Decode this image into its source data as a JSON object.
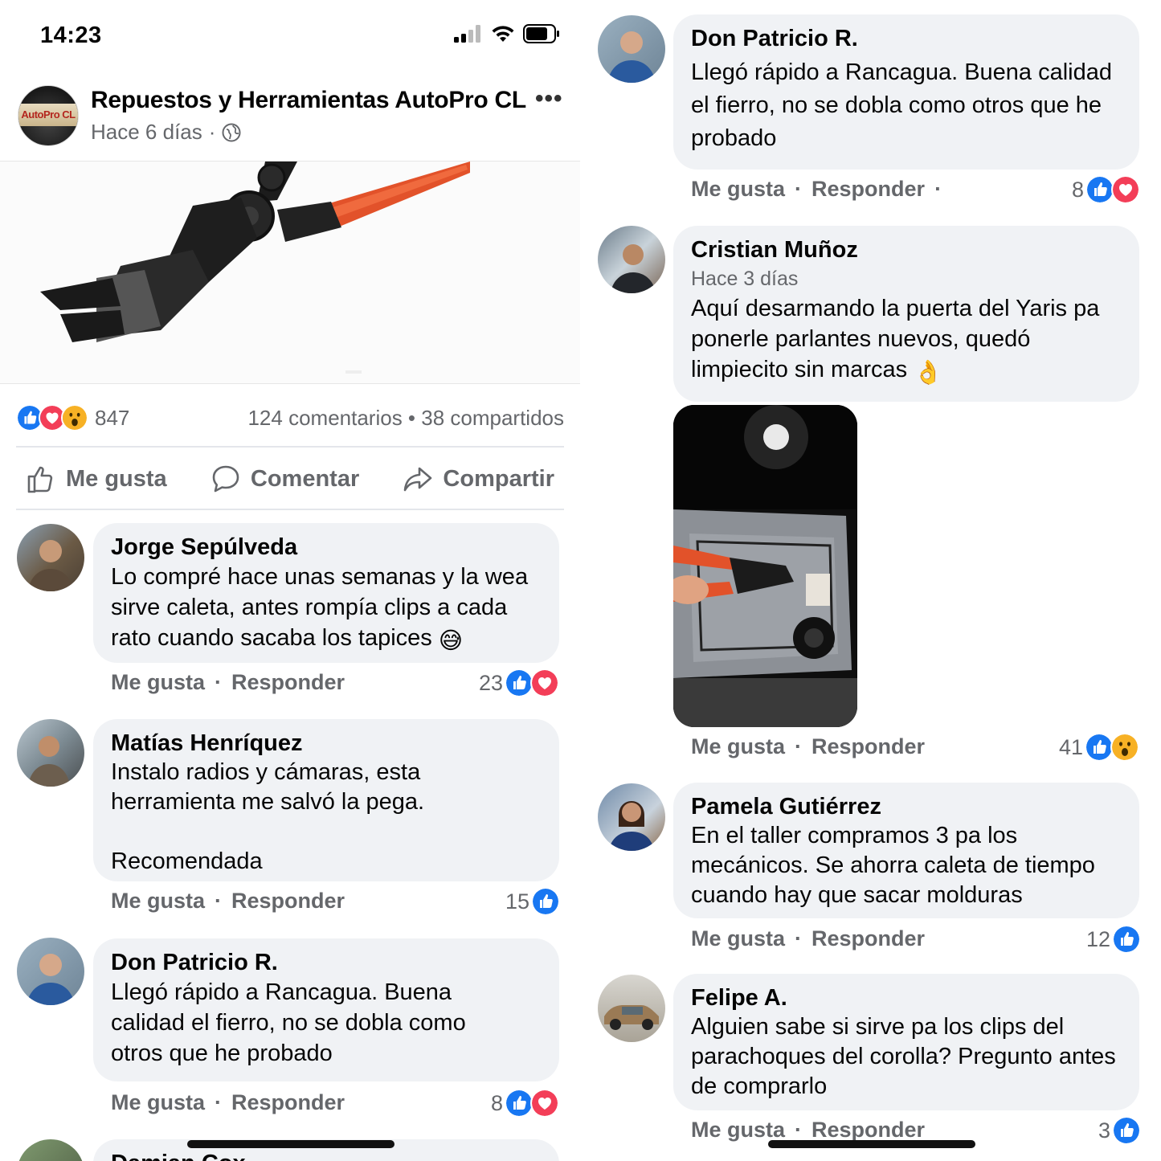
{
  "status_bar": {
    "time": "14:23"
  },
  "post": {
    "page_name": "Repuestos y Herramientas AutoPro CL",
    "avatar_text": "AutoPro CL",
    "time": "Hace 6 días",
    "separator": "·",
    "reaction_count": "847",
    "comments_shares": "124 comentarios • 38 compartidos",
    "actions": {
      "like": "Me gusta",
      "comment": "Comentar",
      "share": "Compartir"
    }
  },
  "comments_left": [
    {
      "author": "Jorge Sepúlveda",
      "text": "Lo compré hace unas semanas y la wea\nsirve caleta, antes rompía clips a cada\nrato cuando sacaba los tapices",
      "emoji": "😅",
      "like": "Me gusta",
      "reply": "Responder",
      "count": "23",
      "reactions": [
        "like",
        "love"
      ]
    },
    {
      "author": "Matías Henríquez",
      "text": "Instalo radios y cámaras, esta\nherramienta me salvó la pega.\n\nRecomendada",
      "like": "Me gusta",
      "reply": "Responder",
      "count": "15",
      "reactions": [
        "like"
      ]
    },
    {
      "author": "Don Patricio R.",
      "text": "Llegó rápido a Rancagua. Buena\ncalidad el fierro, no se dobla como\notros que he probado",
      "like": "Me gusta",
      "reply": "Responder",
      "count": "8",
      "reactions": [
        "like",
        "love"
      ]
    },
    {
      "author": "Damian Cox"
    }
  ],
  "comments_right": [
    {
      "author": "Don Patricio R.",
      "text": "Llegó rápido a Rancagua. Buena calidad\nel fierro, no se dobla como otros que he\nprobado",
      "like": "Me gusta",
      "reply": "Responder",
      "trailing_dot": "·",
      "count": "8",
      "reactions": [
        "like",
        "love"
      ]
    },
    {
      "author": "Cristian Muñoz",
      "time": "Hace 3 días",
      "text": "Aquí desarmando la puerta del Yaris pa\nponerle parlantes nuevos, quedó\nlimpiecito sin marcas",
      "emoji": "👌",
      "like": "Me gusta",
      "reply": "Responder",
      "count": "41",
      "reactions": [
        "like",
        "wow"
      ]
    },
    {
      "author": "Pamela Gutiérrez",
      "text": "En el taller compramos 3 pa los\nmecánicos. Se ahorra caleta de tiempo\ncuando hay que sacar molduras",
      "like": "Me gusta",
      "reply": "Responder",
      "count": "12",
      "reactions": [
        "like"
      ]
    },
    {
      "author": "Felipe A.",
      "text": "Alguien sabe si sirve pa los clips del\nparachoques del corolla? Pregunto antes\nde comprarlo",
      "like": "Me gusta",
      "reply": "Responder",
      "count": "3",
      "reactions": [
        "like"
      ]
    }
  ],
  "icons": {
    "like": "like-reaction-icon",
    "love": "love-reaction-icon",
    "wow": "wow-reaction-icon",
    "globe": "globe-icon",
    "more": "more-icon"
  },
  "colors": {
    "like_blue": "#1877f2",
    "love_red": "#f33e58",
    "wow_yellow": "#f7b125",
    "bubble_bg": "#f0f2f5",
    "meta_gray": "#65676b"
  }
}
